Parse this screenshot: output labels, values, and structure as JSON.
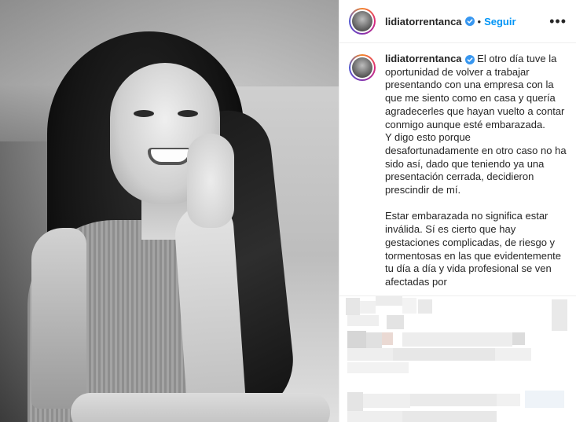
{
  "post": {
    "username": "lidiatorrentanca",
    "follow_label": "Seguir",
    "separator": "•",
    "more_label": "•••",
    "caption_username": "lidiatorrentanca",
    "caption_body": " El otro día tuve la oportunidad de volver a trabajar presentando con una empresa con la que me siento como en casa y quería agradecerles que hayan vuelto a contar conmigo aunque esté embarazada.\nY digo esto porque desafortunadamente en otro caso no ha sido así, dado que teniendo ya una presentación cerrada, decidieron prescindir de mí.\n\nEstar embarazada no significa estar inválida. Sí es cierto que hay gestaciones complicadas, de riesgo y tormentosas en las que evidentemente tu día a día y vida profesional se ven afectadas por"
  },
  "icons": {
    "verified": "verified-badge-icon",
    "more": "more-options-icon"
  },
  "colors": {
    "accent": "#0095f6",
    "verified": "#3897f0",
    "text": "#262626",
    "border": "#efefef"
  }
}
